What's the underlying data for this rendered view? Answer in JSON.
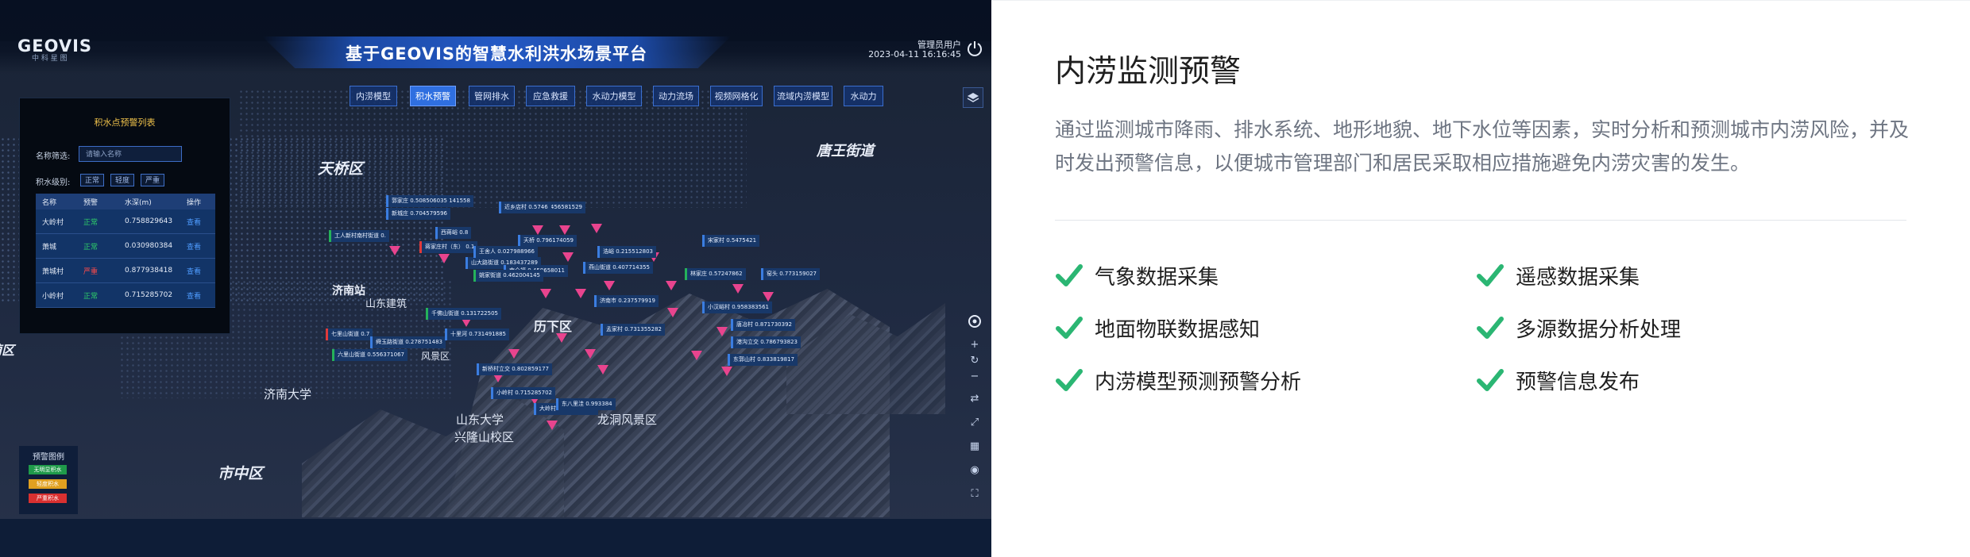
{
  "app": {
    "logo": "GEOVIS",
    "logo_sub": "中 科 星 图",
    "title": "基于GEOVIS的智慧水利洪水场景平台",
    "user": "管理员用户",
    "datetime": "2023-04-11 16:16:45"
  },
  "tabs": [
    {
      "label": "内涝模型",
      "active": false
    },
    {
      "label": "积水预警",
      "active": true
    },
    {
      "label": "管网排水",
      "active": false
    },
    {
      "label": "应急救援",
      "active": false
    },
    {
      "label": "水动力模型",
      "active": false
    },
    {
      "label": "动力流场",
      "active": false
    },
    {
      "label": "视频网格化",
      "active": false
    },
    {
      "label": "流域内涝模型",
      "active": false
    },
    {
      "label": "水动力",
      "active": false
    }
  ],
  "list_panel": {
    "title": "积水点预警列表",
    "filter_label": "名称筛选:",
    "filter_placeholder": "请输入名称",
    "level_label": "积水级别:",
    "levels": [
      "正常",
      "轻度",
      "严重"
    ],
    "columns": [
      "名称",
      "预警",
      "水深(m)",
      "操作"
    ],
    "rows": [
      {
        "name": "大岭村",
        "status": "正常",
        "status_color": "#2fd06a",
        "depth": "0.758829643",
        "action": "查看"
      },
      {
        "name": "萧城",
        "status": "正常",
        "status_color": "#2fd06a",
        "depth": "0.030980384",
        "action": "查看"
      },
      {
        "name": "萧城村",
        "status": "严重",
        "status_color": "#ff4a4a",
        "depth": "0.877938418",
        "action": "查看"
      },
      {
        "name": "小岭村",
        "status": "正常",
        "status_color": "#2fd06a",
        "depth": "0.715285702",
        "action": "查看"
      }
    ]
  },
  "legend": {
    "title": "预警图例",
    "items": [
      {
        "label": "无明显积水",
        "color": "#1f9a4a"
      },
      {
        "label": "轻度积水",
        "color": "#e0a020"
      },
      {
        "label": "严重积水",
        "color": "#d93030"
      }
    ]
  },
  "map_places": {
    "tianqiao": "天桥区",
    "jinan_station": "济南站",
    "shandong_building": "山东建筑",
    "lixia": "历下区",
    "tangye": "唐王街道",
    "jinan_university": "济南大学",
    "shizhong": "市中区",
    "shandong_univ": "山东大学",
    "xinglong": "兴隆山校区",
    "longdong": "龙洞风景区",
    "huaiyin": "槐荫区",
    "fengjing": "风景区"
  },
  "callouts": [
    "郭家庄 0.508506035 141558",
    "新城庄 0.704579596",
    "工人新村南村街道 0.",
    "蒋家庄村（东） 0.1",
    "西蒋峪 0.8",
    "山大路街道 0.183437289",
    "南全福 0.458658011",
    "姚家街道 0.462004145",
    "燕山街道 0.407714355",
    "浩峪 0.215512803",
    "宋家村 0.5475421",
    "林家庄 0.57247862",
    "小汉峪村 0.958383561",
    "唐冶村 0.871730392",
    "港沟立交 0.786793823",
    "东郭山村 0.833819817",
    "千佛山街道 0.131722505",
    "七里山街道 0.7",
    "舜玉路街道 0.278751483",
    "六里山街道 0.556371067",
    "新桥村立交 0.802859177",
    "小岭村 0.715285702",
    "大岭村 0.758829643",
    "济南市 0.237579919",
    "孟家村 0.731355282",
    "天桥 0.796174059",
    "大辛村 0.456581529",
    "近乡店村 0.5746",
    "窑头 0.773159027",
    "王舍人 0.027988966",
    "十里河 0.731491885",
    "东八里洼 0.993384"
  ],
  "intro": {
    "title": "内涝监测预警",
    "description": "通过监测城市降雨、排水系统、地形地貌、地下水位等因素，实时分析和预测城市内涝风险，并及时发出预警信息，以便城市管理部门和居民采取相应措施避免内涝灾害的发生。",
    "accent_color": "#2bb673",
    "features": [
      "气象数据采集",
      "遥感数据采集",
      "地面物联数据感知",
      "多源数据分析处理",
      "内涝模型预测预警分析",
      "预警信息发布"
    ]
  }
}
